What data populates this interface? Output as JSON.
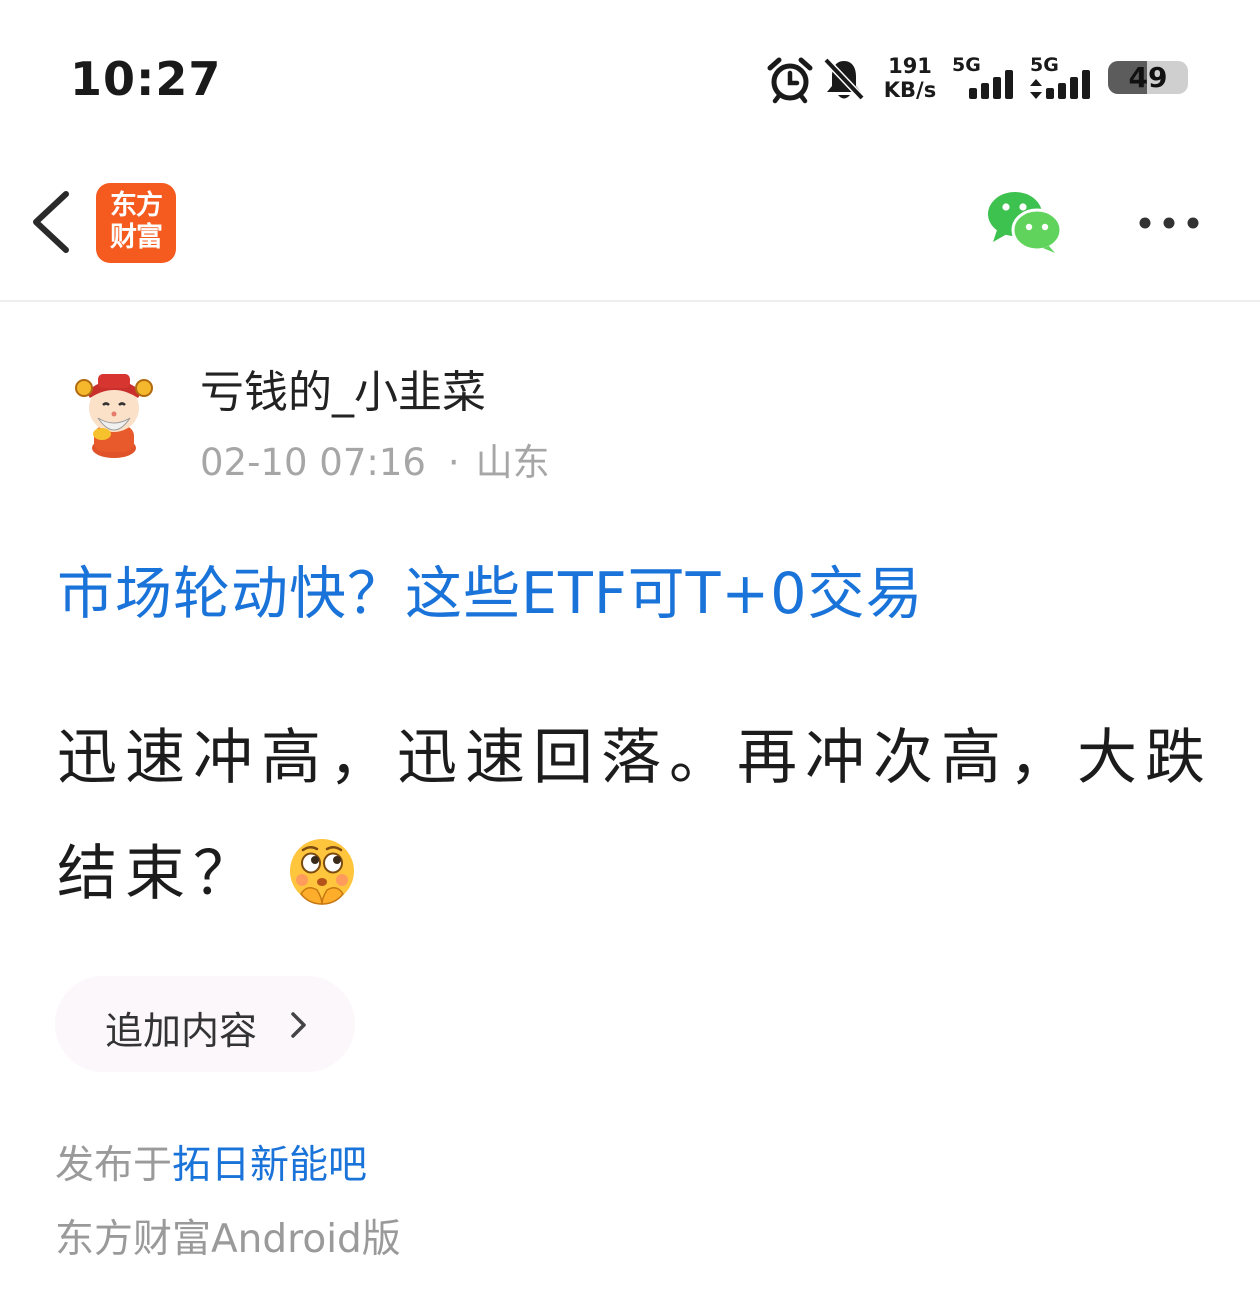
{
  "status_bar": {
    "time": "10:27",
    "net_speed_value": "191",
    "net_speed_unit": "KB/s",
    "sim1_label": "5G",
    "sim2_label": "5G",
    "battery_level": "49",
    "battery_fraction": 0.49,
    "icons": [
      "alarm-icon",
      "bell-muted-icon",
      "signal-icon",
      "signal-icon"
    ]
  },
  "nav": {
    "logo_line1": "东方",
    "logo_line2": "财富",
    "logo_color": "#f55a1f",
    "icons": [
      "back-chevron-icon",
      "wechat-icon",
      "more-dots-icon"
    ]
  },
  "author": {
    "name": "亏钱的_小韭菜",
    "date": "02-10 07:16",
    "dot": "·",
    "location": "山东"
  },
  "post": {
    "title": "市场轮动快？这些ETF可T+0交易",
    "title_color": "#1a73d9",
    "body": "迅速冲高，迅速回落。再冲次高，大跌结束？",
    "emoji_icon": "thinking-face-emoji-icon"
  },
  "actions": {
    "append_label": "追加内容"
  },
  "footer": {
    "published_prefix": "发布于",
    "forum_name": "拓日新能吧",
    "client": "东方财富Android版"
  }
}
